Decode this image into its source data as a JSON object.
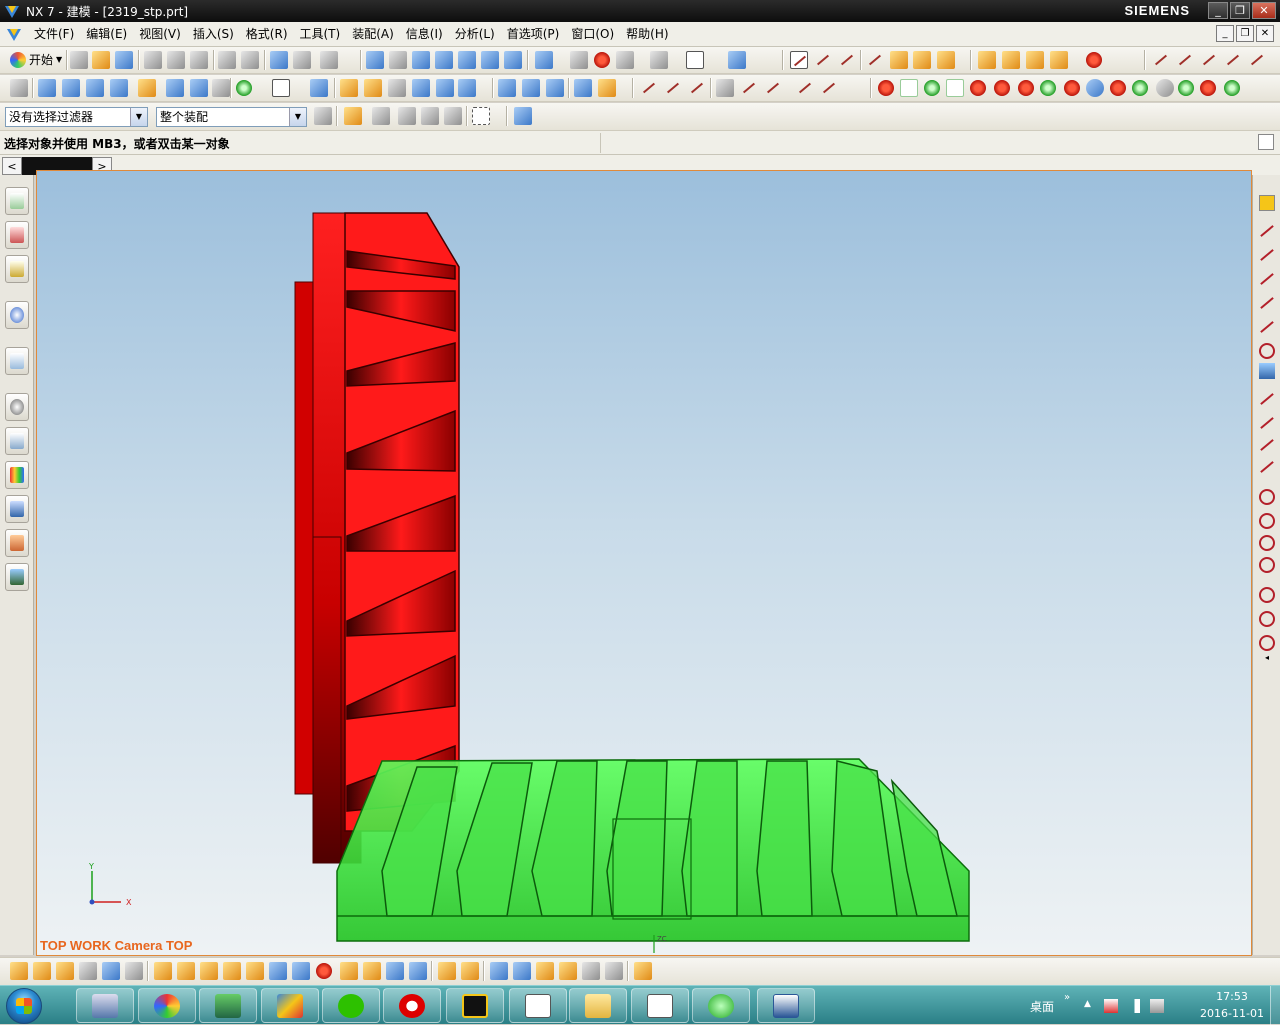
{
  "window": {
    "title": "NX 7 - 建模 - [2319_stp.prt]",
    "brand": "SIEMENS",
    "minimize": "_",
    "maximize": "❐",
    "close": "✕"
  },
  "menu": {
    "items": [
      {
        "label": "文件(F)"
      },
      {
        "label": "编辑(E)"
      },
      {
        "label": "视图(V)"
      },
      {
        "label": "插入(S)"
      },
      {
        "label": "格式(R)"
      },
      {
        "label": "工具(T)"
      },
      {
        "label": "装配(A)"
      },
      {
        "label": "信息(I)"
      },
      {
        "label": "分析(L)"
      },
      {
        "label": "首选项(P)"
      },
      {
        "label": "窗口(O)"
      },
      {
        "label": "帮助(H)"
      }
    ]
  },
  "toolbar": {
    "start_label": "开始"
  },
  "filters": {
    "selection_filter": "没有选择过滤器",
    "assembly_scope": "整个装配"
  },
  "status": {
    "prompt": "选择对象并使用 MB3，或者双击某一对象"
  },
  "tabs": {
    "prev": "<",
    "next": ">"
  },
  "viewport": {
    "view_label": "TOP WORK Camera TOP",
    "axis_x": "X",
    "axis_y": "Y",
    "origin_label": "ZC",
    "colors": {
      "red_part": "#ff1a1a",
      "green_part": "#3ee63e",
      "label": "#e8661e"
    }
  },
  "taskbar": {
    "desktop_label": "桌面",
    "overflow": "»",
    "time": "17:53",
    "date": "2016-11-01",
    "apps": [
      {
        "name": "calculator-icon"
      },
      {
        "name": "paint-icon"
      },
      {
        "name": "remote-desktop-icon"
      },
      {
        "name": "nx-icon"
      },
      {
        "name": "wechat-icon"
      },
      {
        "name": "m-app-icon"
      },
      {
        "name": "a-app-icon"
      },
      {
        "name": "window-icon"
      },
      {
        "name": "folder-icon"
      },
      {
        "name": "window-icon"
      },
      {
        "name": "refresh-app-icon"
      },
      {
        "name": "word-icon"
      }
    ]
  }
}
